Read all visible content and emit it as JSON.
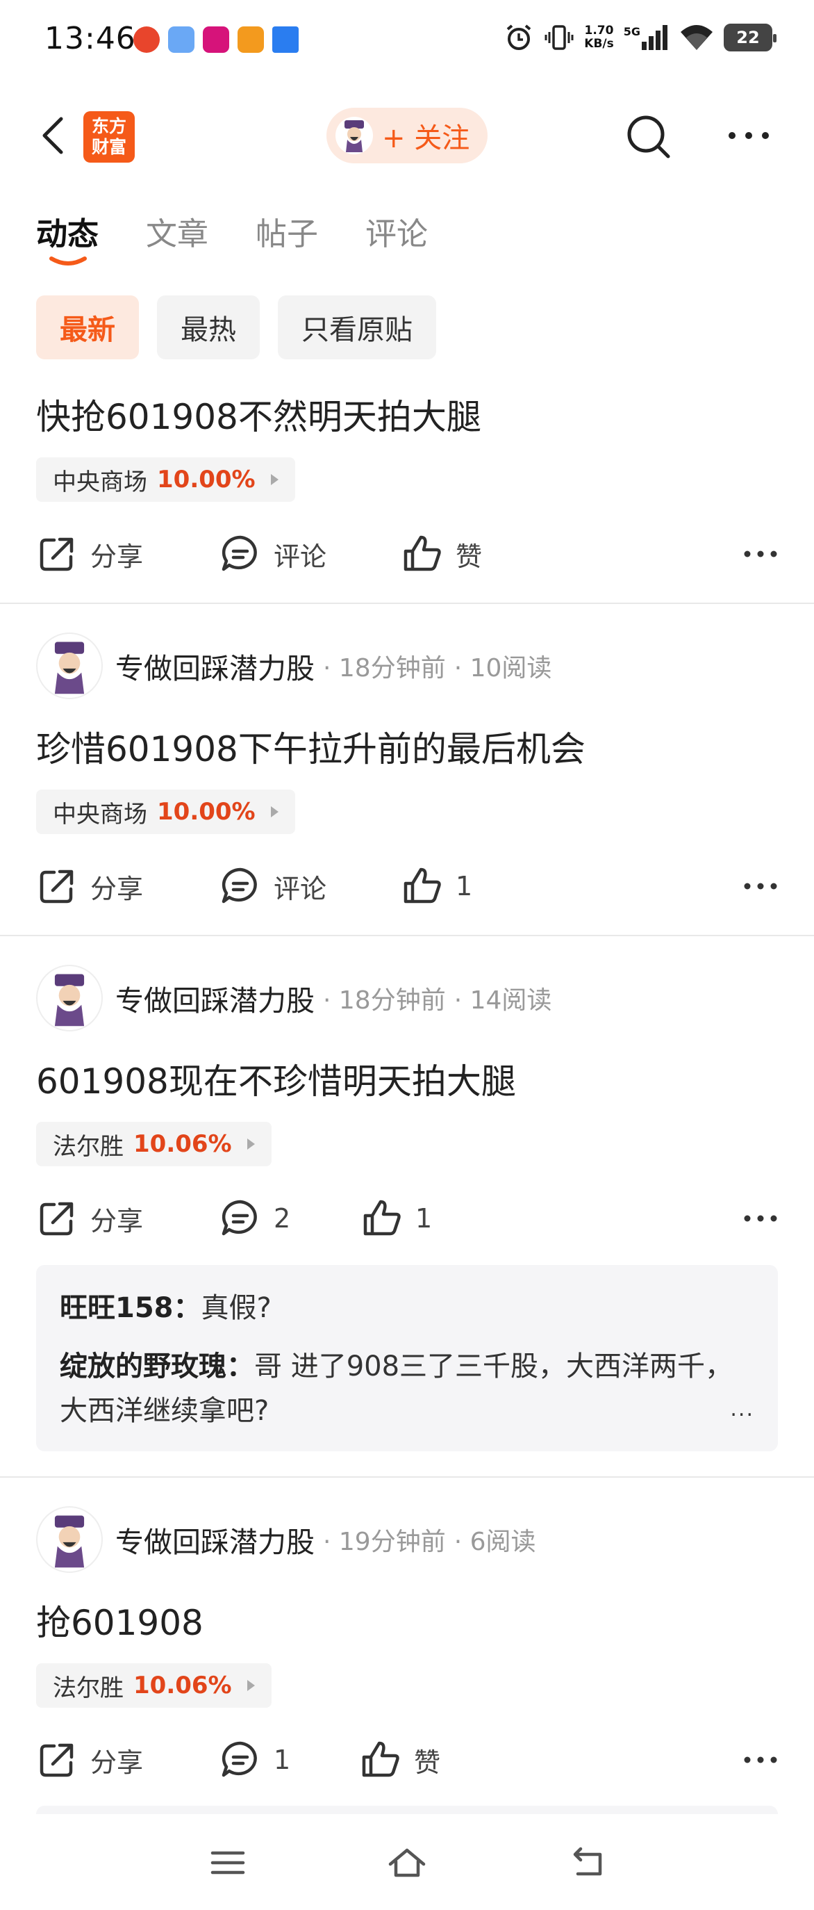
{
  "status_bar": {
    "time": "13:46",
    "net_speed_value": "1.70",
    "net_speed_unit": "KB/s",
    "network": "5G",
    "battery": "22"
  },
  "header": {
    "logo_line1": "东方",
    "logo_line2": "财富",
    "follow_label": "+ 关注"
  },
  "tabs": [
    "动态",
    "文章",
    "帖子",
    "评论"
  ],
  "filters": [
    "最新",
    "最热",
    "只看原贴"
  ],
  "posts": [
    {
      "title": "快抢601908不然明天拍大腿",
      "stock_name": "中央商场",
      "stock_pct": "10.00%",
      "share": "分享",
      "comment": "评论",
      "like": "赞"
    },
    {
      "author": "专做回踩潜力股",
      "time": "· 18分钟前",
      "reads": "· 10阅读",
      "title": "珍惜601908下午拉升前的最后机会",
      "stock_name": "中央商场",
      "stock_pct": "10.00%",
      "share": "分享",
      "comment": "评论",
      "like": "1"
    },
    {
      "author": "专做回踩潜力股",
      "time": "· 18分钟前",
      "reads": "· 14阅读",
      "title": "601908现在不珍惜明天拍大腿",
      "stock_name": "法尔胜",
      "stock_pct": "10.06%",
      "share": "分享",
      "comment": "2",
      "like": "1",
      "comments": [
        {
          "user": "旺旺158：",
          "text": "真假?"
        },
        {
          "user": "绽放的野玫瑰：",
          "text": "哥 进了908三了三千股，大西洋两千，大西洋继续拿吧?"
        }
      ],
      "ellipsis": "..."
    },
    {
      "author": "专做回踩潜力股",
      "time": "· 19分钟前",
      "reads": "· 6阅读",
      "title": "抢601908",
      "stock_name": "法尔胜",
      "stock_pct": "10.06%",
      "share": "分享",
      "comment": "1",
      "like": "赞"
    }
  ],
  "colors": {
    "accent": "#f55a19",
    "accent_bg": "#fde9df",
    "pct_red": "#e2451a"
  }
}
